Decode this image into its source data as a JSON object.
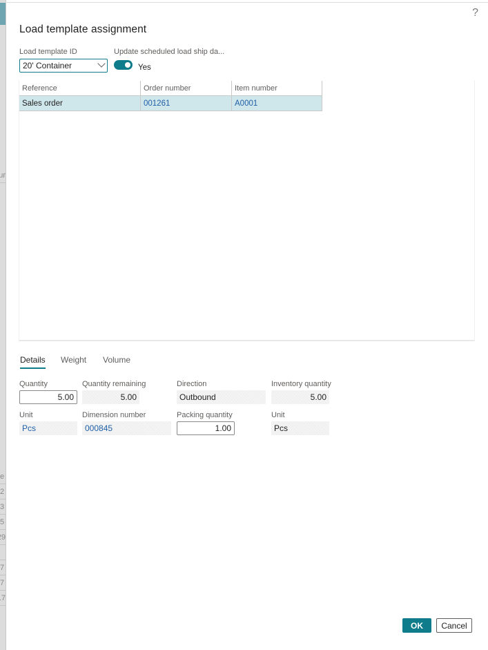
{
  "background": {
    "visible_cells": [
      "ur",
      "e",
      "2",
      "3",
      "5",
      "29",
      "",
      "7",
      "7",
      "17"
    ]
  },
  "dialog": {
    "title": "Load template assignment",
    "help_label": "?",
    "load_template": {
      "label": "Load template ID",
      "value": "20' Container"
    },
    "update_ship_date": {
      "label": "Update scheduled load ship da...",
      "value_label": "Yes",
      "on": true
    },
    "grid": {
      "columns": [
        "Reference",
        "Order number",
        "Item number"
      ],
      "rows": [
        {
          "reference": "Sales order",
          "order_number": "001261",
          "item_number": "A0001"
        }
      ]
    },
    "tabs": [
      {
        "label": "Details",
        "active": true
      },
      {
        "label": "Weight",
        "active": false
      },
      {
        "label": "Volume",
        "active": false
      }
    ],
    "details": {
      "quantity": {
        "label": "Quantity",
        "value": "5.00"
      },
      "quantity_remaining": {
        "label": "Quantity remaining",
        "value": "5.00"
      },
      "direction": {
        "label": "Direction",
        "value": "Outbound"
      },
      "inventory_quantity": {
        "label": "Inventory quantity",
        "value": "5.00"
      },
      "unit": {
        "label": "Unit",
        "value": "Pcs"
      },
      "dimension_number": {
        "label": "Dimension number",
        "value": "000845"
      },
      "packing_quantity": {
        "label": "Packing quantity",
        "value": "1.00"
      },
      "inventory_unit": {
        "label": "Unit",
        "value": "Pcs"
      }
    },
    "buttons": {
      "ok": "OK",
      "cancel": "Cancel"
    }
  },
  "colors": {
    "accent": "#0f7c8c",
    "link": "#1f5fa8",
    "selected_row": "#cfe6eb"
  }
}
